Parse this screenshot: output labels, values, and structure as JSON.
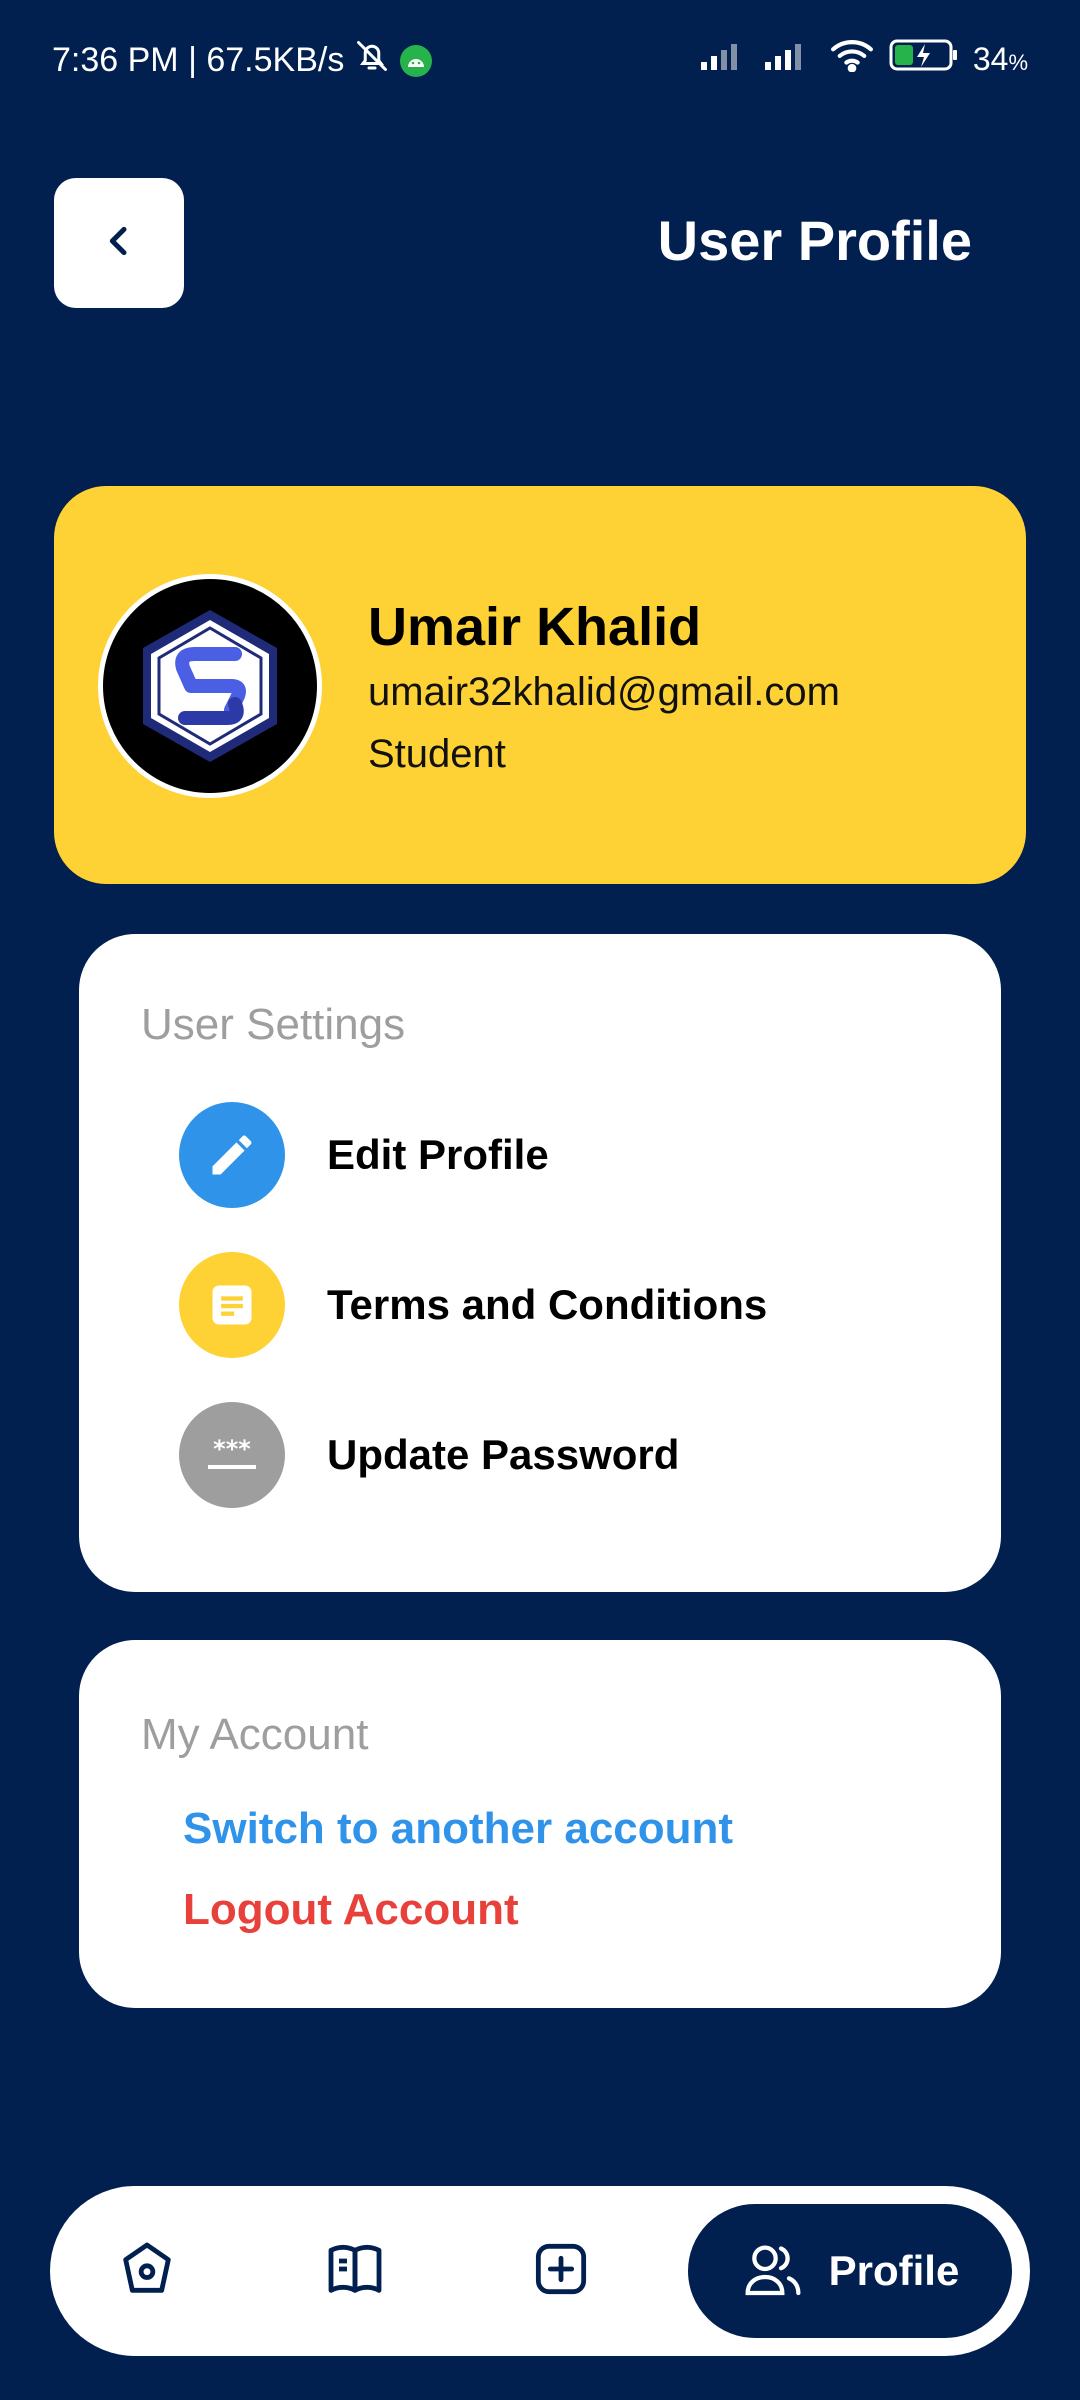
{
  "status": {
    "time_speed": "7:36 PM | 67.5KB/s",
    "battery": "34",
    "battery_unit": "%",
    "icons": [
      "bell-off-icon",
      "android-icon",
      "signal-icon",
      "signal-icon",
      "wifi-icon",
      "battery-charging-icon"
    ]
  },
  "header": {
    "title": "User Profile",
    "back_icon": "chevron-left-icon"
  },
  "profile": {
    "name": "Umair Khalid",
    "email": "umair32khalid@gmail.com",
    "role": "Student",
    "avatar_icon": "hexagon-s-logo"
  },
  "settings": {
    "title": "User Settings",
    "items": [
      {
        "label": "Edit Profile",
        "icon": "pencil-icon",
        "color": "#2f93ea"
      },
      {
        "label": "Terms and Conditions",
        "icon": "document-icon",
        "color": "#fed134"
      },
      {
        "label": "Update Password",
        "icon": "password-icon",
        "color": "#9e9e9e"
      }
    ]
  },
  "account": {
    "title": "My Account",
    "switch_label": "Switch to another account",
    "switch_color": "#2f93ea",
    "logout_label": "Logout Account",
    "logout_color": "#e8403a"
  },
  "nav": {
    "items": [
      {
        "icon": "home-icon"
      },
      {
        "icon": "book-icon"
      },
      {
        "icon": "plus-square-icon"
      }
    ],
    "active": {
      "label": "Profile",
      "icon": "users-icon"
    }
  },
  "colors": {
    "background": "#02204f",
    "accent": "#fed134"
  }
}
